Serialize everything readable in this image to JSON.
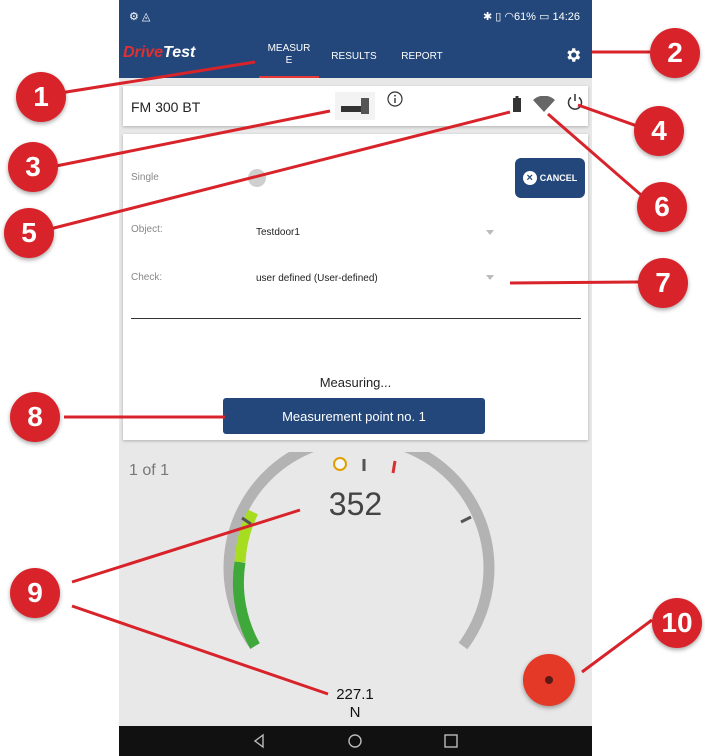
{
  "status_bar": {
    "left_icons": "⚙ ◬",
    "right_text": "✱ ▯ ◠61% ▭ 14:26"
  },
  "app": {
    "logo_drive": "Drive",
    "logo_test": "Test",
    "tabs": [
      {
        "label": "MEASUR\nE"
      },
      {
        "label": "RESULTS"
      },
      {
        "label": "REPORT"
      }
    ]
  },
  "device": {
    "name": "FM 300 BT"
  },
  "form": {
    "single_label": "Single",
    "cancel_label": "CANCEL",
    "object_label": "Object:",
    "object_value": "Testdoor1",
    "check_label": "Check:",
    "check_value": "user defined (User-defined)",
    "measuring_text": "Measuring...",
    "measurement_point_button": "Measurement point no. 1"
  },
  "gauge": {
    "counter": "1 of 1",
    "value": "352",
    "force_value": "227.1",
    "force_unit": "N"
  },
  "callouts": [
    "1",
    "2",
    "3",
    "4",
    "5",
    "6",
    "7",
    "8",
    "9",
    "10"
  ],
  "colors": {
    "primary": "#23477a",
    "accent": "#e53935",
    "callout": "#d8232a",
    "gauge_green": "#4caf3a"
  }
}
